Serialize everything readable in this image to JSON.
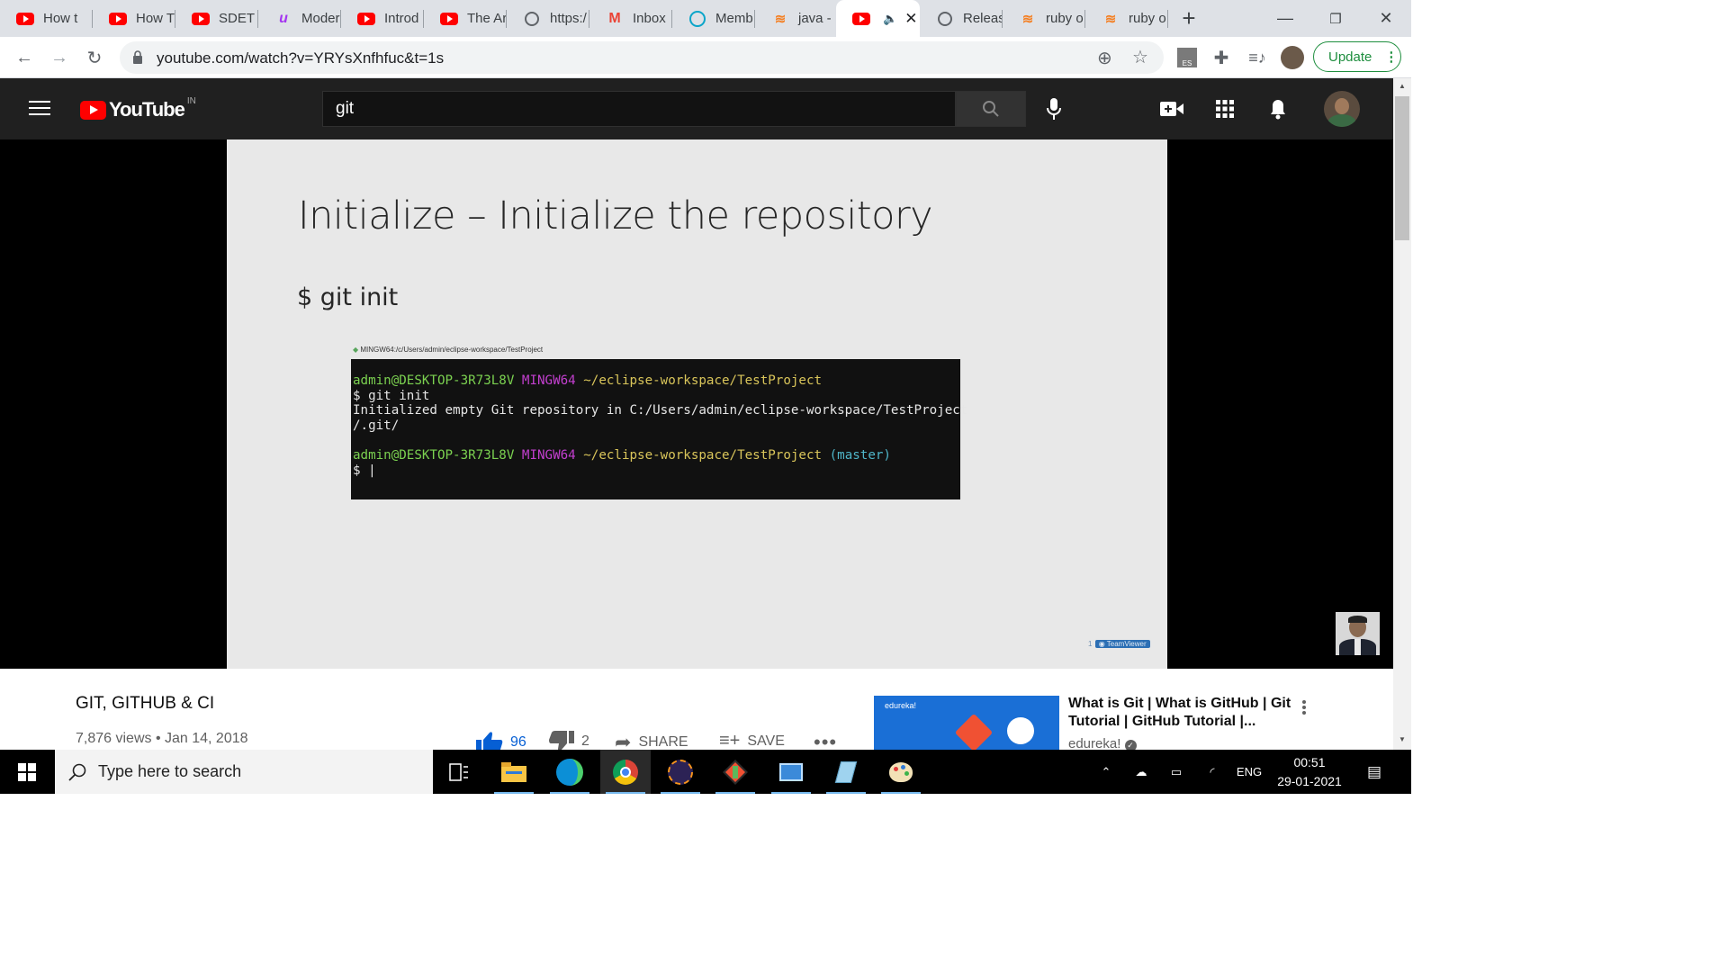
{
  "browser": {
    "tabs": [
      {
        "title": "How t",
        "icon": "youtube-icon"
      },
      {
        "title": "How T",
        "icon": "youtube-icon"
      },
      {
        "title": "SDET -",
        "icon": "youtube-icon"
      },
      {
        "title": "Moder",
        "icon": "udemy-icon"
      },
      {
        "title": "Introd",
        "icon": "youtube-icon"
      },
      {
        "title": "The Ar",
        "icon": "youtube-icon"
      },
      {
        "title": "https:/",
        "icon": "globe-icon"
      },
      {
        "title": "Inbox",
        "icon": "gmail-icon"
      },
      {
        "title": "Memb",
        "icon": "site-icon"
      },
      {
        "title": "java -",
        "icon": "stackoverflow-icon"
      },
      {
        "title": "",
        "icon": "youtube-icon",
        "active": true
      },
      {
        "title": "Releas",
        "icon": "globe-icon"
      },
      {
        "title": "ruby o",
        "icon": "stackoverflow-icon"
      },
      {
        "title": "ruby o",
        "icon": "stackoverflow-icon"
      }
    ],
    "url": "youtube.com/watch?v=YRYsXnfhfuc&t=1s",
    "extension_badge": "ES",
    "update_label": "Update"
  },
  "youtube": {
    "logo_text": "YouTube",
    "region": "IN",
    "search_query": "git"
  },
  "slide": {
    "title": "Initialize – Initialize the repository",
    "command": "$ git init",
    "terminal_caption": "MINGW64:/c/Users/admin/eclipse-workspace/TestProject",
    "terminal": {
      "prompt_user": "admin@DESKTOP-3R73L8V",
      "prompt_env": "MINGW64",
      "prompt_path": "~/eclipse-workspace/TestProject",
      "line2": "$ git init",
      "line3": "Initialized empty Git repository in C:/Users/admin/eclipse-workspace/TestProject",
      "line4": "/.git/",
      "branch": "(master)",
      "cursor_line": "$ |"
    },
    "page_marker": "1",
    "watermark": "TeamViewer"
  },
  "video": {
    "title": "GIT, GITHUB & CI",
    "views": "7,876 views",
    "date": "Jan 14, 2018",
    "likes": "96",
    "dislikes": "2",
    "share_label": "SHARE",
    "save_label": "SAVE"
  },
  "recommendation": {
    "thumb_brand": "edureka!",
    "title": "What is Git | What is GitHub | Git Tutorial | GitHub Tutorial |...",
    "channel": "edureka!"
  },
  "taskbar": {
    "search_placeholder": "Type here to search",
    "lang": "ENG",
    "time": "00:51",
    "date": "29-01-2021"
  }
}
